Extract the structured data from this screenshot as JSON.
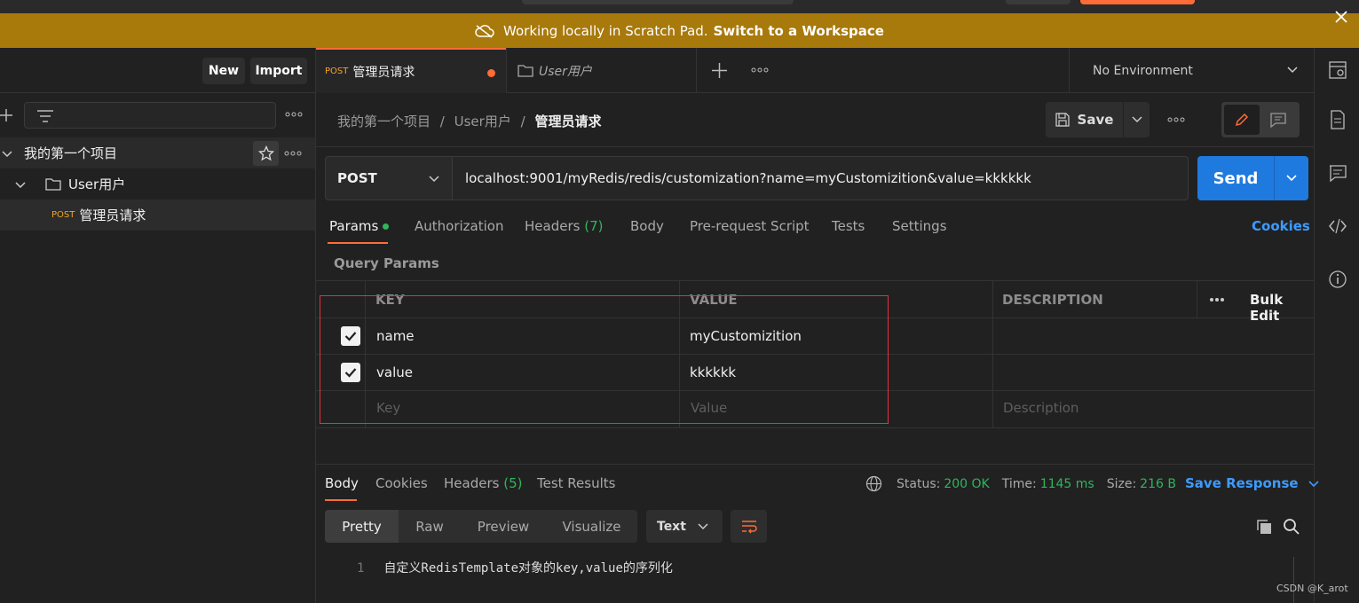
{
  "banner": {
    "message": "Working locally in Scratch Pad.",
    "switch_label": "Switch to a Workspace"
  },
  "sidebar": {
    "new_label": "New",
    "import_label": "Import",
    "project_name": "我的第一个项目",
    "folder_name": "User用户",
    "request_method": "POST",
    "request_name": "管理员请求"
  },
  "tabs": [
    {
      "method": "POST",
      "label": "管理员请求",
      "unsaved": true
    },
    {
      "label": "User用户"
    }
  ],
  "environment": {
    "selected": "No Environment"
  },
  "breadcrumb": {
    "project": "我的第一个项目",
    "folder": "User用户",
    "current": "管理员请求",
    "separator": "/"
  },
  "toolbar": {
    "save_label": "Save"
  },
  "request": {
    "method": "POST",
    "url": "localhost:9001/myRedis/redis/customization?name=myCustomizition&value=kkkkkk",
    "send_label": "Send"
  },
  "request_tabs": {
    "params": "Params",
    "authorization": "Authorization",
    "headers": "Headers",
    "headers_count": "(7)",
    "body": "Body",
    "prerequest": "Pre-request Script",
    "tests": "Tests",
    "settings": "Settings",
    "cookies": "Cookies"
  },
  "query_params": {
    "title": "Query Params",
    "columns": {
      "key": "KEY",
      "value": "VALUE",
      "description": "DESCRIPTION",
      "bulk_edit": "Bulk Edit"
    },
    "rows": [
      {
        "checked": true,
        "key": "name",
        "value": "myCustomizition",
        "description": ""
      },
      {
        "checked": true,
        "key": "value",
        "value": "kkkkkk",
        "description": ""
      }
    ],
    "placeholders": {
      "key": "Key",
      "value": "Value",
      "description": "Description"
    }
  },
  "response": {
    "tabs": {
      "body": "Body",
      "cookies": "Cookies",
      "headers": "Headers",
      "headers_count": "(5)",
      "test_results": "Test Results"
    },
    "status_label": "Status:",
    "status_value": "200 OK",
    "time_label": "Time:",
    "time_value": "1145 ms",
    "size_label": "Size:",
    "size_value": "216 B",
    "save_response": "Save Response",
    "formats": {
      "pretty": "Pretty",
      "raw": "Raw",
      "preview": "Preview",
      "visualize": "Visualize"
    },
    "language": "Text",
    "body_lines": [
      {
        "number": "1",
        "text": "自定义RedisTemplate对象的key,value的序列化"
      }
    ]
  },
  "watermark": "CSDN @K_arot",
  "colors": {
    "accent": "#ff6c37",
    "send": "#1f7ae0",
    "banner": "#a8790b",
    "success": "#2fb55b",
    "link": "#3d9bff",
    "highlight_box": "#e0343d"
  }
}
